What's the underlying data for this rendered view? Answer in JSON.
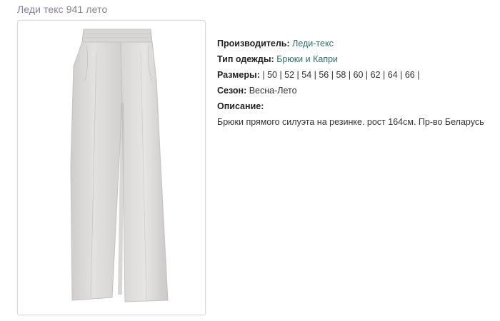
{
  "title": "Леди текс 941 лето",
  "colors": {
    "title": "#8a7d9a",
    "link": "#2d6e6e",
    "text": "#333333",
    "pants_fabric": "#dcdad9"
  },
  "product_image": {
    "icon": "trousers-photo"
  },
  "details": {
    "manufacturer_label": "Производитель:",
    "manufacturer_value": "Леди-текс",
    "type_label": "Тип одежды:",
    "type_value": "Брюки и Капри",
    "sizes_label": "Размеры:",
    "sizes_value": "| 50 | 52 | 54 | 56 | 58 | 60 | 62 | 64 | 66 |",
    "season_label": "Сезон:",
    "season_value": "Весна-Лето",
    "description_label": "Описание:",
    "description_value": "Брюки прямого силуэта на резинке. рост 164см. Пр-во Беларусь"
  }
}
